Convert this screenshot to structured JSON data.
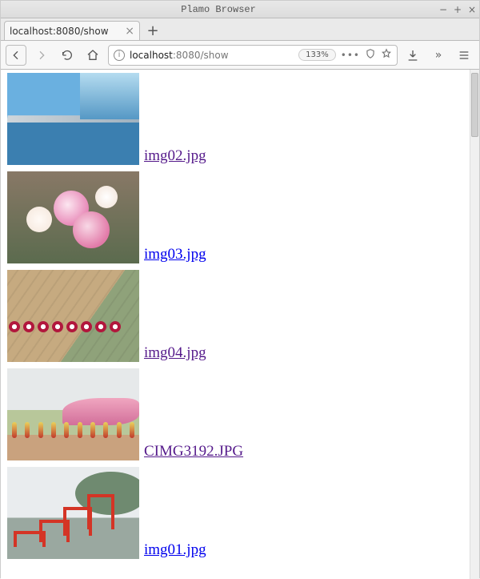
{
  "window": {
    "title": "Plamo Browser"
  },
  "tab": {
    "label": "localhost:8080/show"
  },
  "url": {
    "host": "localhost",
    "rest": ":8080/show",
    "zoom": "133%"
  },
  "icons": {
    "back": "back-icon",
    "forward": "forward-icon",
    "reload": "reload-icon",
    "home": "home-icon",
    "info": "i",
    "dots": "•••",
    "bookmark": "star-icon",
    "download": "download-icon",
    "overflow": "»",
    "menu": "menu-icon",
    "shield": "shield-icon",
    "close_tab": "×",
    "new_tab": "+",
    "win_min": "−",
    "win_max": "+",
    "win_close": "×"
  },
  "entries": [
    {
      "file": " img02.jpg"
    },
    {
      "file": " img03.jpg"
    },
    {
      "file": " img04.jpg"
    },
    {
      "file": " CIMG3192.JPG"
    },
    {
      "file": " img01.jpg"
    }
  ]
}
